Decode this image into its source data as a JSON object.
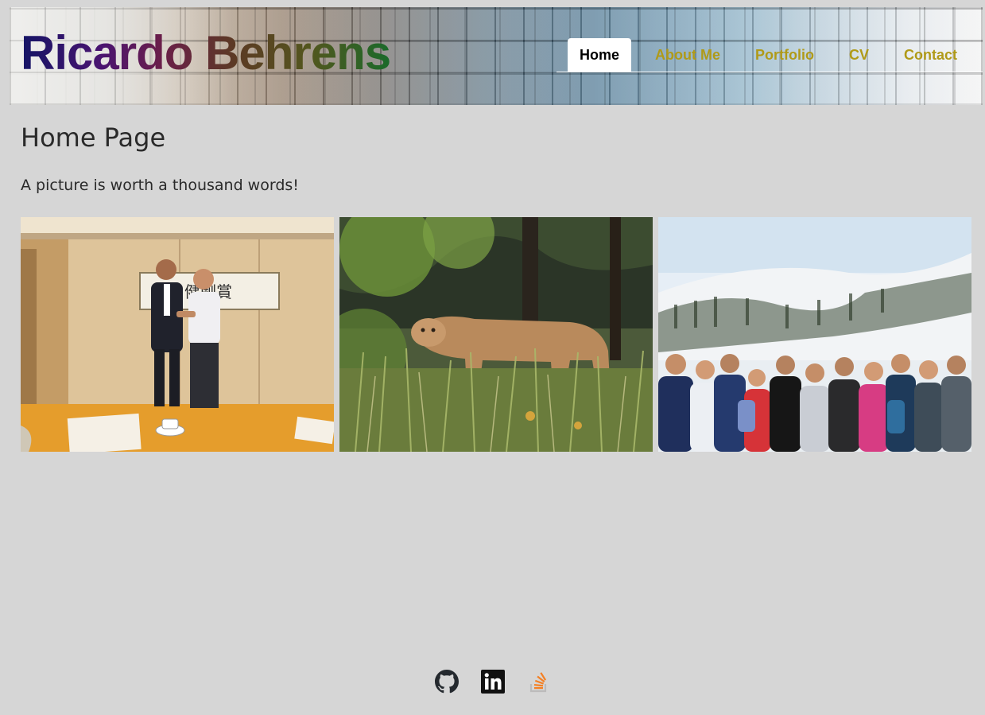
{
  "header": {
    "brand": "Ricardo Behrens",
    "nav": [
      {
        "label": "Home",
        "active": true
      },
      {
        "label": "About Me",
        "active": false
      },
      {
        "label": "Portfolio",
        "active": false
      },
      {
        "label": "CV",
        "active": false
      },
      {
        "label": "Contact",
        "active": false
      }
    ],
    "colors": {
      "nav_text": "#b09a18",
      "nav_active_bg": "#ffffff"
    }
  },
  "main": {
    "title": "Home Page",
    "subtitle": "A picture is worth a thousand words!",
    "gallery": [
      {
        "icon": "photo-business-handshake"
      },
      {
        "icon": "photo-mountain-lion"
      },
      {
        "icon": "photo-ski-group"
      }
    ]
  },
  "footer": {
    "social": [
      {
        "icon": "github-icon",
        "color": "#24292e"
      },
      {
        "icon": "linkedin-icon",
        "color": "#111111"
      },
      {
        "icon": "stackoverflow-icon",
        "color": "#f48024"
      }
    ]
  },
  "page_background": "#d6d6d6"
}
